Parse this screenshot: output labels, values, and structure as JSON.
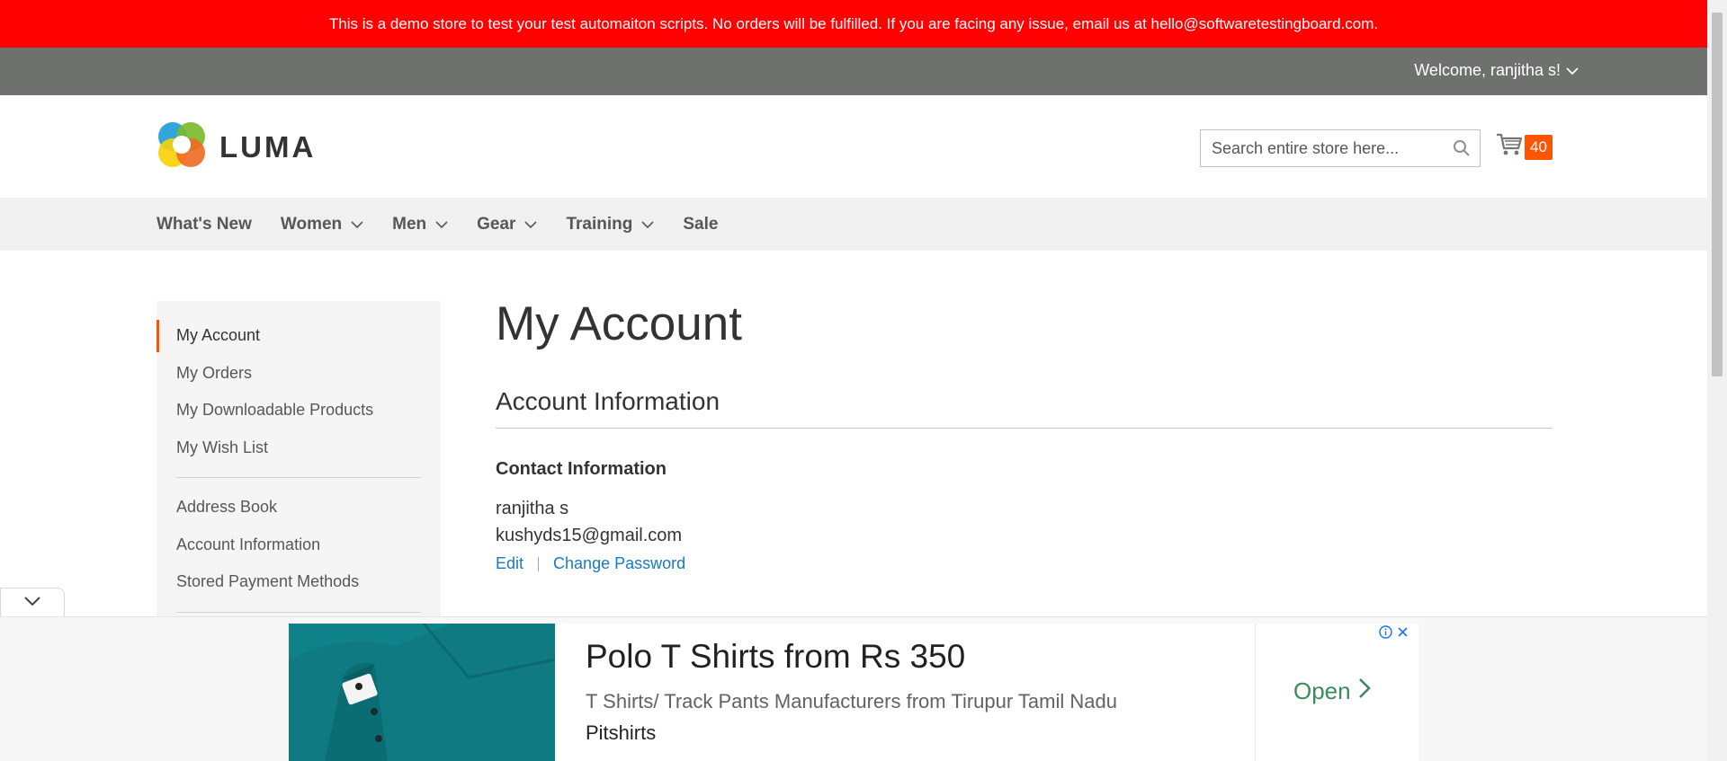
{
  "demo_banner": "This is a demo store to test your test automaiton scripts. No orders will be fulfilled. If you are facing any issue, email us at hello@softwaretestingboard.com.",
  "header": {
    "welcome": "Welcome, ranjitha s!",
    "logo_text": "LUMA",
    "search_placeholder": "Search entire store here...",
    "cart_count": "40"
  },
  "nav": {
    "items": [
      {
        "label": "What's New"
      },
      {
        "label": "Women"
      },
      {
        "label": "Men"
      },
      {
        "label": "Gear"
      },
      {
        "label": "Training"
      },
      {
        "label": "Sale"
      }
    ]
  },
  "sidebar": {
    "items": [
      {
        "label": "My Account"
      },
      {
        "label": "My Orders"
      },
      {
        "label": "My Downloadable Products"
      },
      {
        "label": "My Wish List"
      },
      {
        "label": "Address Book"
      },
      {
        "label": "Account Information"
      },
      {
        "label": "Stored Payment Methods"
      }
    ]
  },
  "main": {
    "page_title": "My Account",
    "section_title": "Account Information",
    "box_title": "Contact Information",
    "name": "ranjitha s",
    "email": "kushyds15@gmail.com",
    "edit_label": "Edit",
    "change_password_label": "Change Password"
  },
  "ad": {
    "headline": "Polo T Shirts from Rs 350",
    "description": "T Shirts/ Track Pants Manufacturers from Tirupur Tamil Nadu",
    "brand": "Pitshirts",
    "cta": "Open"
  },
  "colors": {
    "banner": "#ff0101",
    "welcome_bar": "#6e716e",
    "cart_badge": "#ff5501",
    "link": "#1979c3",
    "active_marker": "#ff5501"
  }
}
